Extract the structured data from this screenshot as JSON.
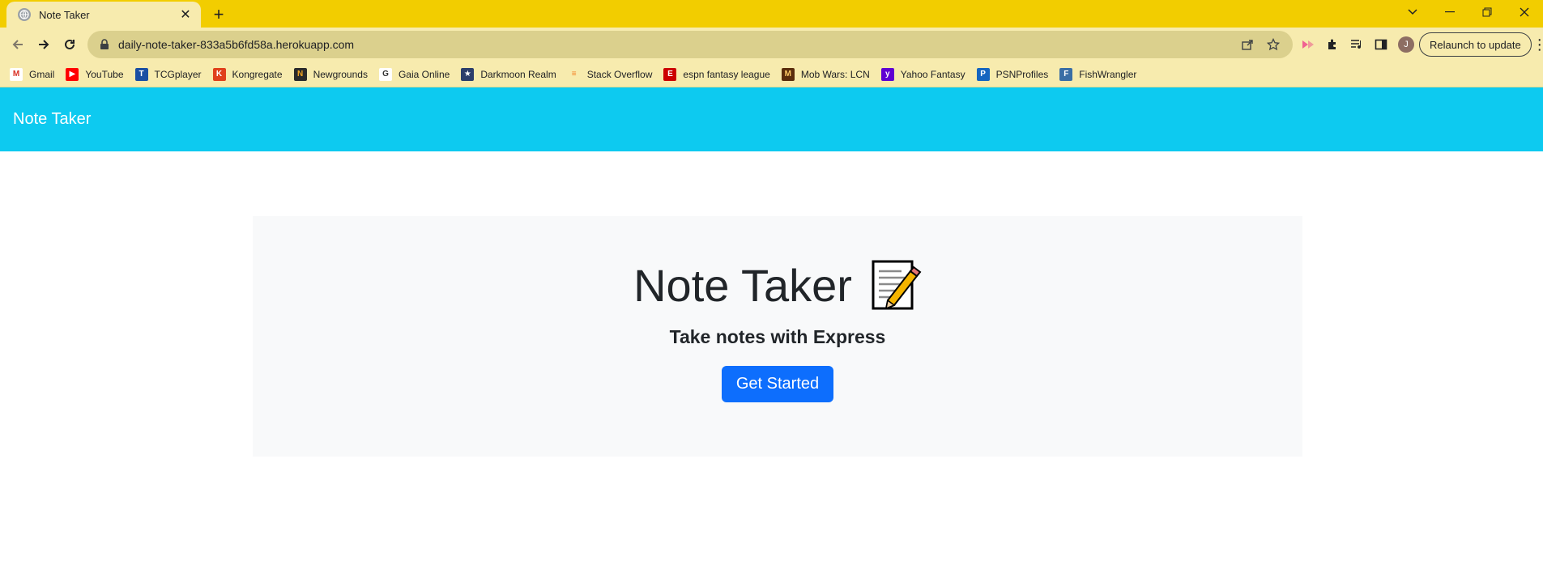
{
  "browser": {
    "tab_title": "Note Taker",
    "tab_close": "✕",
    "new_tab": "+",
    "url": "daily-note-taker-833a5b6fd58a.herokuapp.com",
    "relaunch_label": "Relaunch to update",
    "avatar_initial": "J",
    "accent_color": "#f2cd00"
  },
  "bookmarks": [
    {
      "label": "Gmail",
      "icon": "gmail-icon",
      "color": "#ffffff",
      "glyph": "M",
      "glyph_color": "#d93025"
    },
    {
      "label": "YouTube",
      "icon": "youtube-icon",
      "color": "#ff0000",
      "glyph": "▶",
      "glyph_color": "#ffffff"
    },
    {
      "label": "TCGplayer",
      "icon": "tcgplayer-icon",
      "color": "#1a4fa3",
      "glyph": "T",
      "glyph_color": "#ffffff"
    },
    {
      "label": "Kongregate",
      "icon": "kongregate-icon",
      "color": "#e0401b",
      "glyph": "K",
      "glyph_color": "#ffffff"
    },
    {
      "label": "Newgrounds",
      "icon": "newgrounds-icon",
      "color": "#2b2b2b",
      "glyph": "N",
      "glyph_color": "#f5a623"
    },
    {
      "label": "Gaia Online",
      "icon": "gaia-online-icon",
      "color": "#ffffff",
      "glyph": "G",
      "glyph_color": "#333333"
    },
    {
      "label": "Darkmoon Realm",
      "icon": "darkmoon-realm-icon",
      "color": "#2c3e6b",
      "glyph": "★",
      "glyph_color": "#ffffff"
    },
    {
      "label": "Stack Overflow",
      "icon": "stack-overflow-icon",
      "color": "#f7ebae",
      "glyph": "≡",
      "glyph_color": "#f48024"
    },
    {
      "label": "espn fantasy league",
      "icon": "espn-icon",
      "color": "#cc0000",
      "glyph": "E",
      "glyph_color": "#ffffff"
    },
    {
      "label": "Mob Wars: LCN",
      "icon": "mob-wars-icon",
      "color": "#5a2d0c",
      "glyph": "M",
      "glyph_color": "#ffcc66"
    },
    {
      "label": "Yahoo Fantasy",
      "icon": "yahoo-fantasy-icon",
      "color": "#6001d2",
      "glyph": "y",
      "glyph_color": "#ffffff"
    },
    {
      "label": "PSNProfiles",
      "icon": "psnprofiles-icon",
      "color": "#1565c0",
      "glyph": "P",
      "glyph_color": "#ffffff"
    },
    {
      "label": "FishWrangler",
      "icon": "fishwrangler-icon",
      "color": "#3a6ea5",
      "glyph": "F",
      "glyph_color": "#ffffff"
    }
  ],
  "page": {
    "brand": "Note Taker",
    "hero_title": "Note Taker",
    "hero_subtitle": "Take notes with Express",
    "cta_label": "Get Started",
    "navbar_color": "#0dcaf0",
    "cta_color": "#0d6efd"
  }
}
